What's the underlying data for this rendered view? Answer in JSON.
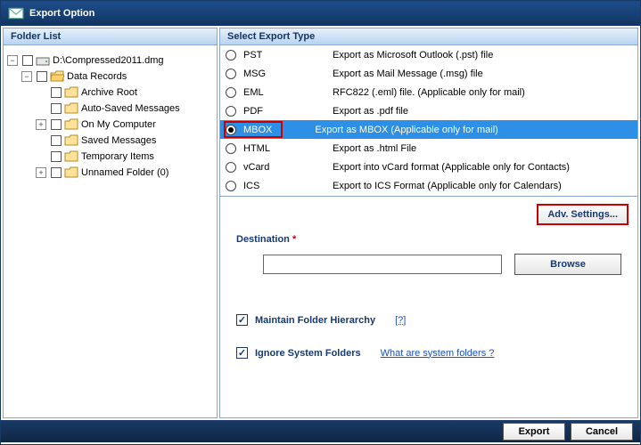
{
  "window": {
    "title": "Export Option"
  },
  "leftPanel": {
    "header": "Folder List"
  },
  "tree": {
    "root": "D:\\Compressed2011.dmg",
    "items": [
      {
        "label": "Data Records",
        "depth": 1,
        "toggle": "-"
      },
      {
        "label": "Archive Root",
        "depth": 2,
        "toggle": ""
      },
      {
        "label": "Auto-Saved Messages",
        "depth": 2,
        "toggle": ""
      },
      {
        "label": "On My Computer",
        "depth": 2,
        "toggle": "+"
      },
      {
        "label": "Saved Messages",
        "depth": 2,
        "toggle": ""
      },
      {
        "label": "Temporary Items",
        "depth": 2,
        "toggle": ""
      },
      {
        "label": "Unnamed Folder (0)",
        "depth": 2,
        "toggle": "+"
      }
    ]
  },
  "rightPanel": {
    "header": "Select Export Type"
  },
  "exportTypes": [
    {
      "type": "PST",
      "desc": "Export as Microsoft Outlook (.pst) file",
      "selected": false
    },
    {
      "type": "MSG",
      "desc": "Export as Mail Message (.msg) file",
      "selected": false
    },
    {
      "type": "EML",
      "desc": "RFC822 (.eml) file. (Applicable only for mail)",
      "selected": false
    },
    {
      "type": "PDF",
      "desc": "Export as .pdf file",
      "selected": false
    },
    {
      "type": "MBOX",
      "desc": "Export as MBOX (Applicable only for mail)",
      "selected": true
    },
    {
      "type": "HTML",
      "desc": "Export as .html File",
      "selected": false
    },
    {
      "type": "vCard",
      "desc": "Export into vCard format (Applicable only for Contacts)",
      "selected": false
    },
    {
      "type": "ICS",
      "desc": "Export to ICS Format (Applicable only for Calendars)",
      "selected": false
    }
  ],
  "form": {
    "advSettings": "Adv. Settings...",
    "destinationLabel": "Destination",
    "destinationValue": "",
    "browse": "Browse",
    "maintainHierarchy": "Maintain Folder Hierarchy",
    "helpSymbol": "[?]",
    "ignoreSystem": "Ignore System Folders",
    "systemLink": "What are system folders ?"
  },
  "footer": {
    "export": "Export",
    "cancel": "Cancel"
  }
}
